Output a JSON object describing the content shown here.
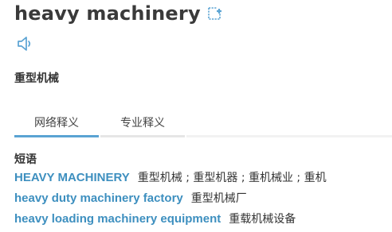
{
  "word": {
    "title": "heavy machinery",
    "translation": "重型机械"
  },
  "icons": {
    "add": "add-to-wordbook-icon",
    "pronounce": "speaker-icon"
  },
  "colors": {
    "accent": "#5aa3d3",
    "link": "#3d8fbf",
    "text": "#333333"
  },
  "tabs": [
    {
      "label": "网络释义",
      "active": true
    },
    {
      "label": "专业释义",
      "active": false
    }
  ],
  "phrases": {
    "section_title": "短语",
    "items": [
      {
        "term": "HEAVY MACHINERY",
        "definition": "重型机械 ; 重型机器 ; 重机械业 ; 重机"
      },
      {
        "term": "heavy duty machinery factory",
        "definition": "重型机械厂"
      },
      {
        "term": "heavy loading machinery equipment",
        "definition": "重载机械设备"
      }
    ]
  }
}
